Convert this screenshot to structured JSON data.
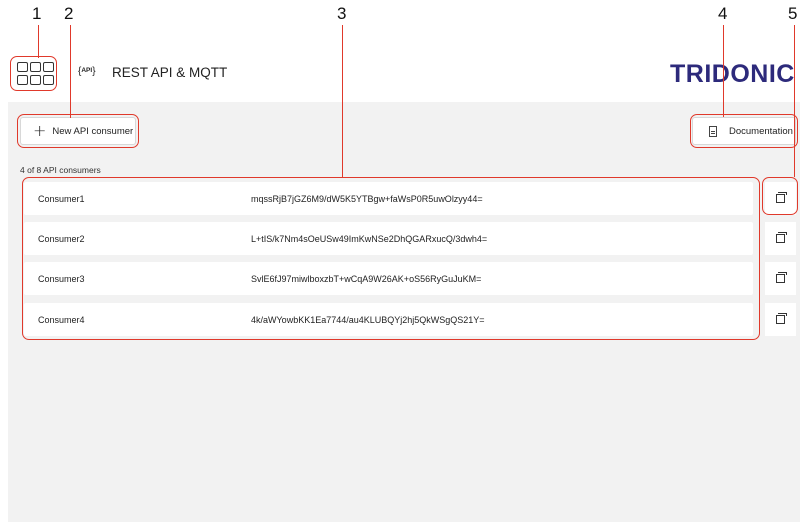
{
  "callouts": [
    "1",
    "2",
    "3",
    "4",
    "5"
  ],
  "header": {
    "api_badge": "API",
    "title": "REST API & MQTT",
    "brand": "TRIDONIC"
  },
  "toolbar": {
    "new_consumer_label": "New API consumer",
    "documentation_label": "Documentation"
  },
  "consumers_count": "4 of 8 API consumers",
  "consumers": [
    {
      "name": "Consumer1",
      "key": "mqssRjB7jGZ6M9/dW5K5YTBgw+faWsP0R5uwOlzyy44="
    },
    {
      "name": "Consumer2",
      "key": "L+tIS/k7Nm4sOeUSw49ImKwNSe2DhQGARxucQ/3dwh4="
    },
    {
      "name": "Consumer3",
      "key": "SvlE6fJ97miwlboxzbT+wCqA9W26AK+oS56RyGuJuKM="
    },
    {
      "name": "Consumer4",
      "key": "4k/aWYowbKK1Ea7744/au4KLUBQYj2hj5QkWSgQS21Y="
    }
  ],
  "icons": {
    "app_menu": "app-grid-icon",
    "add": "plus-icon",
    "documentation": "document-icon",
    "copy": "copy-icon"
  },
  "colors": {
    "brand": "#2d2a7b",
    "callout": "#e0392b",
    "background": "#f2f2f2"
  }
}
